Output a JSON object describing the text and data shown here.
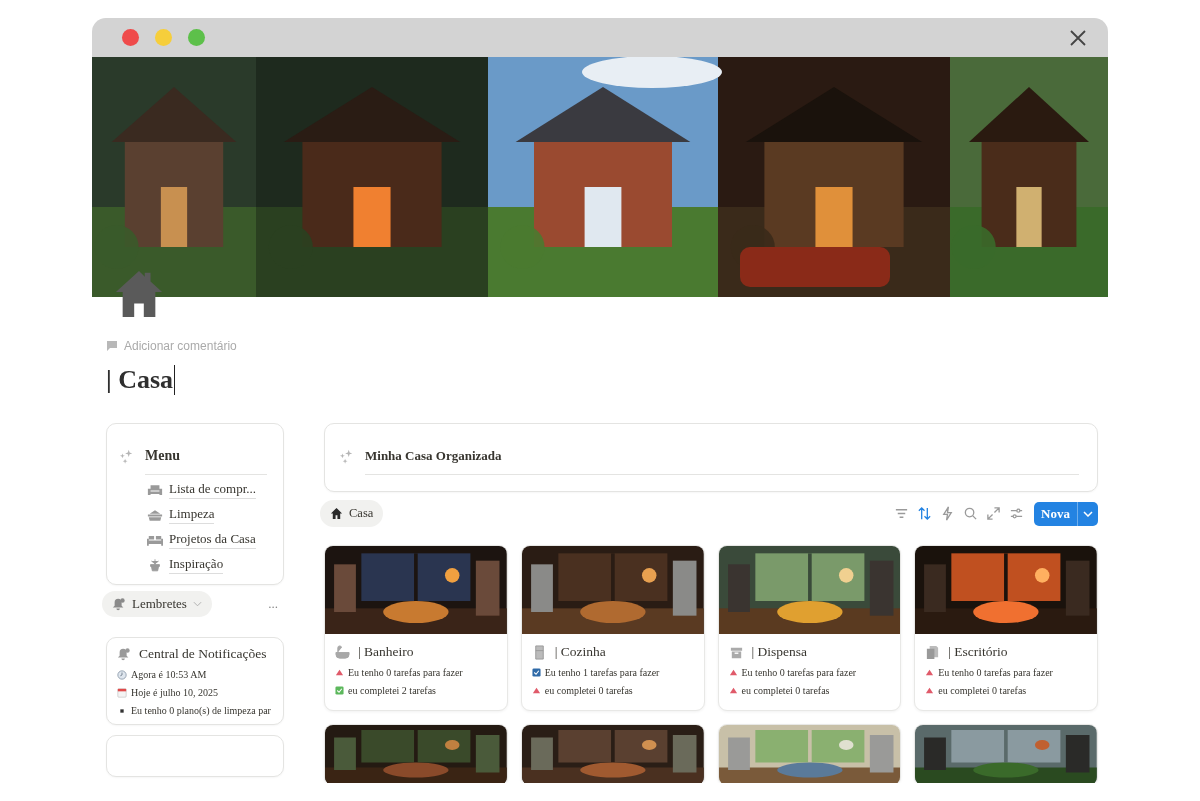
{
  "page": {
    "comment_link": "Adicionar comentário",
    "title": "| Casa"
  },
  "menu": {
    "title": "Menu",
    "items": [
      {
        "kind": "sofa",
        "label": "Lista de compr..."
      },
      {
        "kind": "basket",
        "label": "Limpeza"
      },
      {
        "kind": "couch",
        "label": "Projetos da Casa"
      },
      {
        "kind": "plant",
        "label": "Inspiração"
      }
    ]
  },
  "reminders": {
    "label": "Lembretes",
    "more": "..."
  },
  "notifications": {
    "title": "Central de Notificações",
    "items": [
      {
        "kind": "clock",
        "text": "Agora é 10:53 AM"
      },
      {
        "kind": "calendar",
        "text": "Hoje é julho 10, 2025"
      },
      {
        "kind": "bullet",
        "text": "Eu tenho 0 plano(s) de limpeza par"
      }
    ]
  },
  "header": {
    "title": "Minha Casa Organizada"
  },
  "view_tab": {
    "label": "Casa",
    "selected": true
  },
  "toolbar": [
    {
      "kind": "filter",
      "active": false
    },
    {
      "kind": "sort",
      "active": true
    },
    {
      "kind": "bolt",
      "active": false
    },
    {
      "kind": "search",
      "active": false
    },
    {
      "kind": "expand",
      "active": false
    },
    {
      "kind": "sliders",
      "active": false
    }
  ],
  "new_button": {
    "label": "Nova"
  },
  "cards": [
    {
      "kind": "room",
      "title": "| Banheiro",
      "lines": [
        {
          "kind": "alert",
          "text": "Eu tenho 0 tarefas para fazer"
        },
        {
          "kind": "done",
          "text": "eu completei 2 tarefas"
        }
      ]
    },
    {
      "kind": "room",
      "title": "| Cozinha",
      "lines": [
        {
          "kind": "checkbox",
          "text": "Eu tenho 1 tarefas para fazer"
        },
        {
          "kind": "alert",
          "text": "eu completei 0 tarefas"
        }
      ]
    },
    {
      "kind": "room",
      "title": "| Dispensa",
      "lines": [
        {
          "kind": "alert",
          "text": "Eu tenho 0 tarefas para fazer"
        },
        {
          "kind": "alert",
          "text": "eu completei 0 tarefas"
        }
      ]
    },
    {
      "kind": "room",
      "title": "| Escritório",
      "lines": [
        {
          "kind": "alert",
          "text": "Eu tenho 0 tarefas para fazer"
        },
        {
          "kind": "alert",
          "text": "eu completei 0 tarefas"
        }
      ]
    },
    {
      "kind": "picture"
    },
    {
      "kind": "picture"
    },
    {
      "kind": "picture"
    },
    {
      "kind": "picture"
    }
  ]
}
